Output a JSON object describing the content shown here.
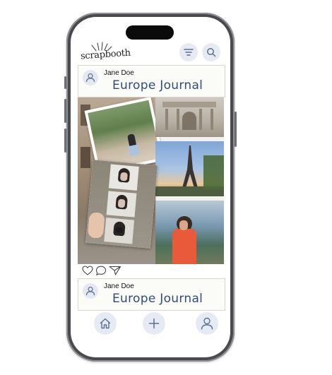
{
  "app": {
    "logo_text": "scrapbooth"
  },
  "posts": [
    {
      "user_name": "Jane Doe",
      "title": "Europe Journal"
    },
    {
      "user_name": "Jane Doe",
      "title": "Europe Journal"
    }
  ],
  "icons": {
    "filter": "filter-icon",
    "search": "search-icon",
    "like": "heart-icon",
    "comment": "comment-icon",
    "share": "send-icon",
    "home": "home-icon",
    "add": "plus-icon",
    "profile": "user-icon"
  },
  "colors": {
    "accent": "#2f4c7a",
    "button_bg": "#e6ebf3",
    "icon": "#5a6f92"
  }
}
